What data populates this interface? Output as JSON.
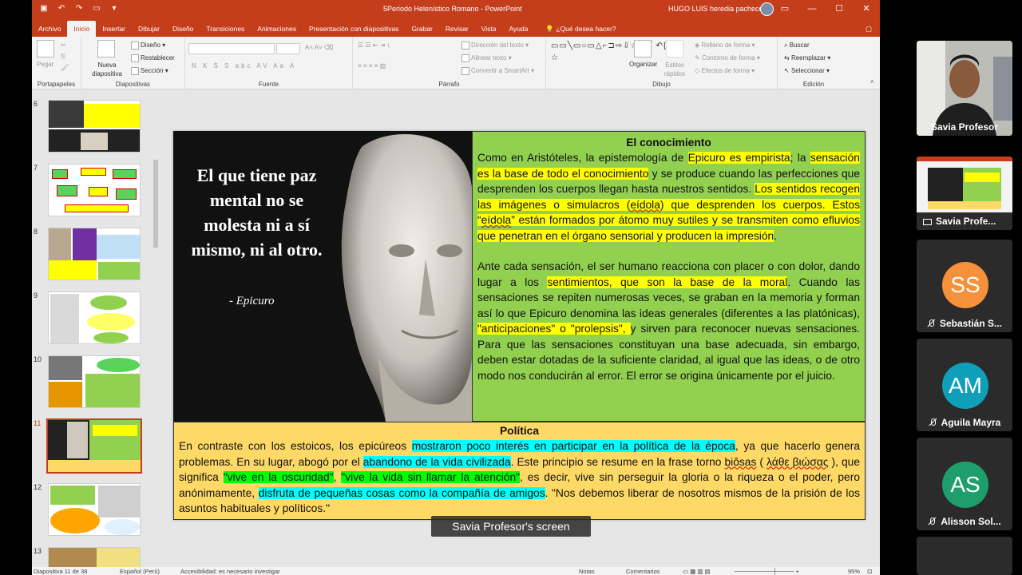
{
  "window": {
    "title": "5Periodo Helenístico Romano  -  PowerPoint",
    "user": "HUGO LUIS heredia pacheco"
  },
  "tabs": [
    "Archivo",
    "Inicio",
    "Insertar",
    "Dibujar",
    "Diseño",
    "Transiciones",
    "Animaciones",
    "Presentación con diapositivas",
    "Grabar",
    "Revisar",
    "Vista",
    "Ayuda"
  ],
  "tell_me": "¿Qué desea hacer?",
  "ribbon": {
    "portapapeles": {
      "label": "Portapapeles",
      "paste": "Pegar"
    },
    "diapositivas": {
      "label": "Diapositivas",
      "new_slide": "Nueva diapositiva",
      "layout": "Diseño",
      "reset": "Restablecer",
      "section": "Sección"
    },
    "fuente": {
      "label": "Fuente",
      "buttons": "N  K  S  S  abc  AV  Aa  A"
    },
    "parrafo": {
      "label": "Párrafo",
      "text_direction": "Dirección del texto",
      "align_text": "Alinear texto",
      "smartart": "Convertir a SmartArt"
    },
    "dibujo": {
      "label": "Dibujo",
      "arrange": "Organizar",
      "quick_styles": "Estilos rápidos",
      "shape_fill": "Relleno de forma",
      "shape_outline": "Contorno de forma",
      "shape_effects": "Efectos de forma"
    },
    "edicion": {
      "label": "Edición",
      "find": "Buscar",
      "replace": "Reemplazar",
      "select": "Seleccionar"
    }
  },
  "thumbnails": [
    {
      "num": "6"
    },
    {
      "num": "7"
    },
    {
      "num": "8"
    },
    {
      "num": "9"
    },
    {
      "num": "10"
    },
    {
      "num": "11"
    },
    {
      "num": "12"
    },
    {
      "num": "13"
    }
  ],
  "slide": {
    "quote": "El que tiene paz mental no se molesta ni a sí mismo, ni al otro.",
    "quote_author": "- Epicuro",
    "knowledge_title": "El conocimiento",
    "k": {
      "p1a": "Como en Aristóteles, la epistemología de ",
      "p1b": "Epicuro es empirista",
      "p1c": "; la ",
      "p1d": "sensación es la base de todo el conocimiento",
      "p1e": " y se produce cuando las perfecciones que desprenden los cuerpos llegan hasta nuestros sentidos. ",
      "p1f": "Los sentidos recogen las imágenes o simulacros (",
      "p1g": "eídola",
      "p1h": ") que desprenden los cuerpos. Estos “",
      "p1i": "eídola",
      "p1j": "” están formados por átomo muy sutiles y se transmiten como efluvios que penetran en el órgano sensorial y producen la impresión",
      "p1k": ".",
      "p2a": "Ante cada sensación, el ser humano reacciona con placer o con dolor, dando lugar a los ",
      "p2b": "sentimientos, que son la base de la moral",
      "p2c": ". Cuando las sensaciones se repiten numerosas veces, se graban en la memoria y forman así lo que Epicuro denomina las ideas generales (diferentes a las platónicas), ",
      "p2d": "\"anticipaciones\" o \"prolepsis\", ",
      "p2e": "y sirven para reconocer nuevas sensaciones. Para que las sensaciones constituyan una base adecuada, sin embargo, deben estar dotadas de la suficiente claridad, al igual que las ideas, o de otro modo nos conducirán al error. El error se origina únicamente por el juicio."
    },
    "politics_title": "Política",
    "p": {
      "a": "En contraste con los estoicos, los epicúreos ",
      "b": "mostraron poco interés en participar en la política de la época",
      "c": ", ya que hacerlo genera problemas. En su lugar, abogó por el ",
      "d": "abandono de la vida civilizada",
      "e": ". Este principio se resume en la frase torno ",
      "f": "biôsas",
      "g": " ( ",
      "h": "λάθε βιώσας",
      "i": " ), que significa ",
      "j": "\"vive en la oscuridad\"",
      "k": ", ",
      "l": "\"vive la vida sin llamar la atención\"",
      "m": ", es decir, vive sin perseguir la gloria o la riqueza o el poder, pero anónimamente, ",
      "n": "disfruta de pequeñas cosas como la compañía de amigos",
      "o": ". \"Nos debemos liberar de nosotros mismos de la prisión de los asuntos habituales y políticos.\""
    }
  },
  "caption": "Savia Profesor's screen",
  "statusbar": {
    "slide_count": "Diapositiva 11 de 38",
    "language": "Español (Perú)",
    "accessibility": "Accesibilidad: es necesario investigar",
    "notes": "Notas",
    "comments": "Comentarios",
    "zoom": "95%"
  },
  "participants": [
    {
      "name": "Savia Profesor",
      "kind": "video"
    },
    {
      "name": "Savia Profe...",
      "kind": "screen"
    },
    {
      "name": "Sebastián S...",
      "initials": "SS",
      "color": "#f5913a"
    },
    {
      "name": "Aguila Mayra",
      "initials": "AM",
      "color": "#0f9fb8"
    },
    {
      "name": "Alisson Sol...",
      "initials": "AS",
      "color": "#1e9e6a"
    }
  ]
}
